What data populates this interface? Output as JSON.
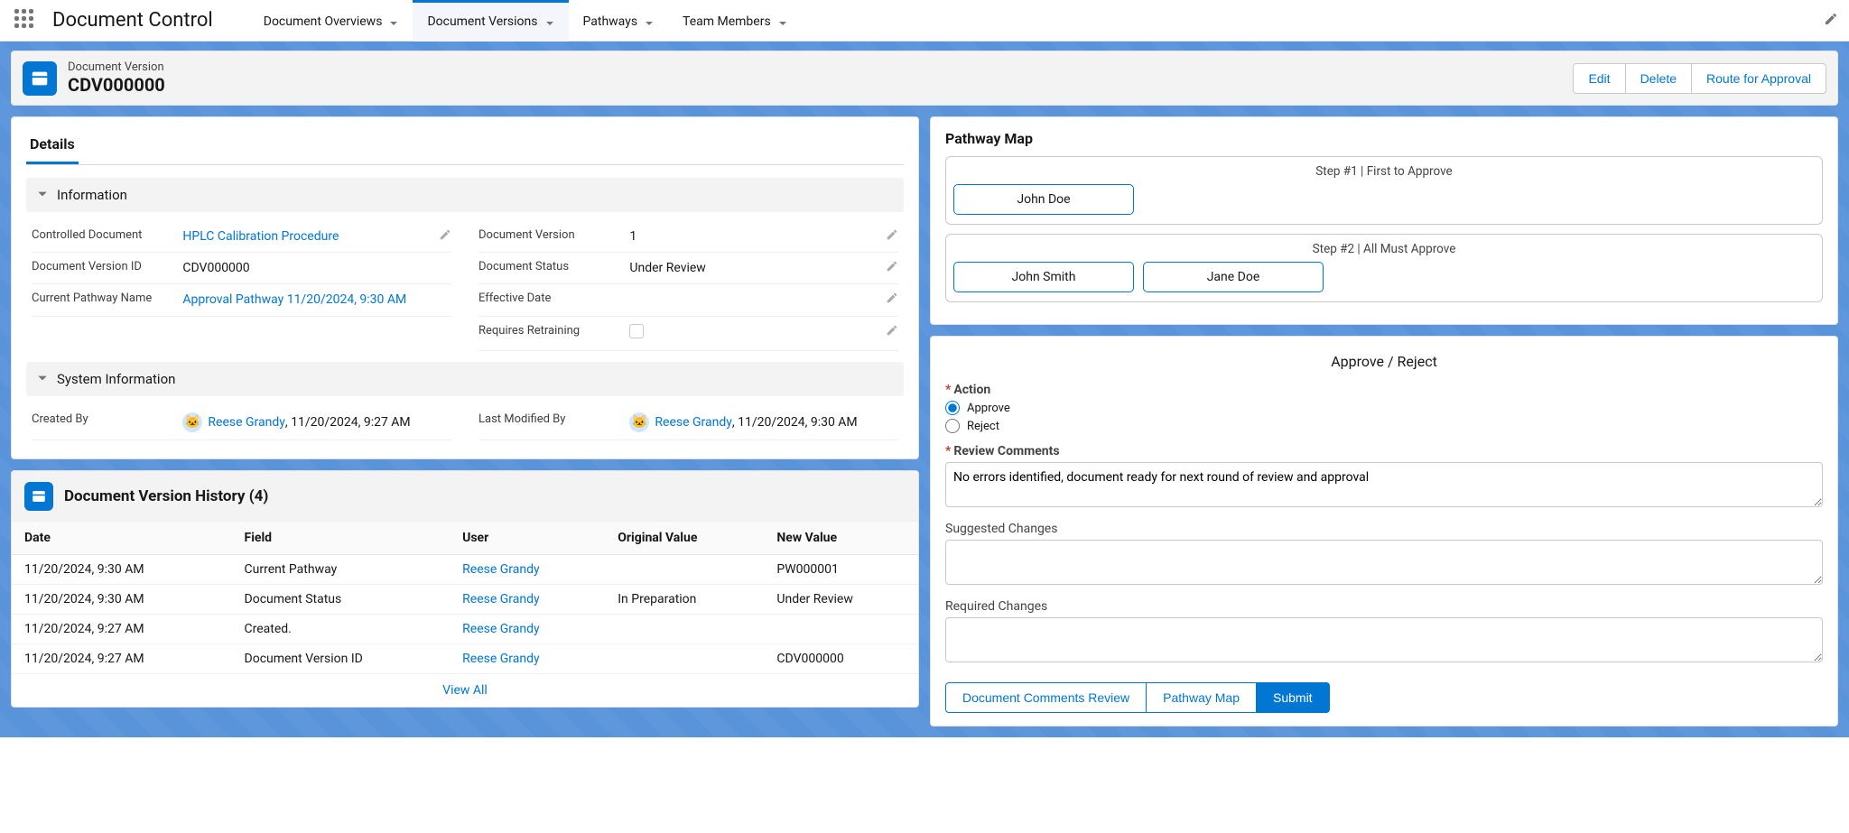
{
  "app": {
    "title": "Document Control"
  },
  "nav": {
    "tabs": [
      {
        "label": "Document Overviews",
        "active": false
      },
      {
        "label": "Document Versions",
        "active": true
      },
      {
        "label": "Pathways",
        "active": false
      },
      {
        "label": "Team Members",
        "active": false
      }
    ]
  },
  "record": {
    "kicker": "Document Version",
    "title": "CDV000000",
    "actions": {
      "edit": "Edit",
      "delete": "Delete",
      "route": "Route for Approval"
    }
  },
  "details": {
    "tab_label": "Details",
    "section_info": "Information",
    "section_sys": "System Information",
    "fields": {
      "controlled_document": {
        "label": "Controlled Document",
        "value": "HPLC Calibration Procedure",
        "link": true
      },
      "document_version": {
        "label": "Document Version",
        "value": "1"
      },
      "document_version_id": {
        "label": "Document Version ID",
        "value": "CDV000000"
      },
      "document_status": {
        "label": "Document Status",
        "value": "Under Review"
      },
      "current_pathway_name": {
        "label": "Current Pathway Name",
        "value": "Approval Pathway 11/20/2024, 9:30 AM",
        "link": true
      },
      "effective_date": {
        "label": "Effective Date",
        "value": ""
      },
      "requires_retraining": {
        "label": "Requires Retraining",
        "checked": false
      }
    },
    "sys": {
      "created_by": {
        "label": "Created By",
        "user": "Reese Grandy",
        "ts": "11/20/2024, 9:27 AM"
      },
      "last_modified_by": {
        "label": "Last Modified By",
        "user": "Reese Grandy",
        "ts": "11/20/2024, 9:30 AM"
      }
    }
  },
  "history": {
    "title": "Document Version History",
    "count": "(4)",
    "columns": [
      "Date",
      "Field",
      "User",
      "Original Value",
      "New Value"
    ],
    "rows": [
      {
        "date": "11/20/2024, 9:30 AM",
        "field": "Current Pathway",
        "user": "Reese Grandy",
        "orig": "",
        "new": "PW000001"
      },
      {
        "date": "11/20/2024, 9:30 AM",
        "field": "Document Status",
        "user": "Reese Grandy",
        "orig": "In Preparation",
        "new": "Under Review"
      },
      {
        "date": "11/20/2024, 9:27 AM",
        "field": "Created.",
        "user": "Reese Grandy",
        "orig": "",
        "new": ""
      },
      {
        "date": "11/20/2024, 9:27 AM",
        "field": "Document Version ID",
        "user": "Reese Grandy",
        "orig": "",
        "new": "CDV000000"
      }
    ],
    "view_all": "View All"
  },
  "pathway_map": {
    "title": "Pathway Map",
    "steps": [
      {
        "label": "Step #1 | First to Approve",
        "people": [
          "John Doe"
        ]
      },
      {
        "label": "Step #2 | All Must Approve",
        "people": [
          "John Smith",
          "Jane Doe"
        ]
      }
    ]
  },
  "approve_panel": {
    "title": "Approve / Reject",
    "action_label": "Action",
    "options": {
      "approve": "Approve",
      "reject": "Reject"
    },
    "selected": "approve",
    "review_comments_label": "Review Comments",
    "review_comments_value": "No errors identified, document ready for next round of review and approval",
    "suggested_changes_label": "Suggested Changes",
    "suggested_changes_value": "",
    "required_changes_label": "Required Changes",
    "required_changes_value": "",
    "buttons": {
      "doc_comments": "Document Comments Review",
      "pathway_map": "Pathway Map",
      "submit": "Submit"
    }
  }
}
